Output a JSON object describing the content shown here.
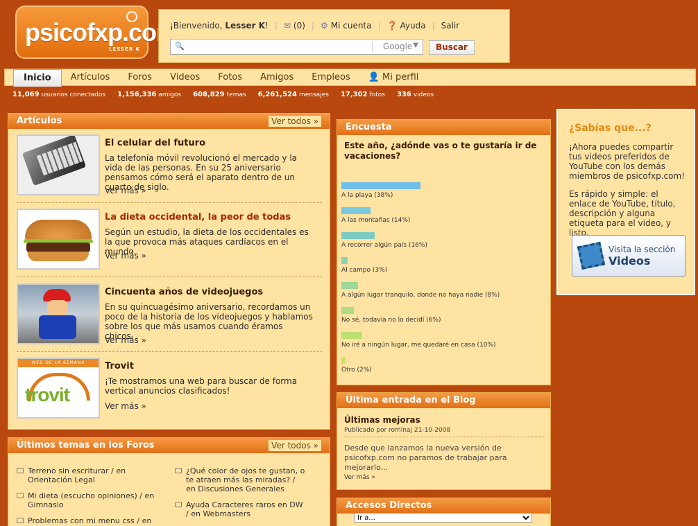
{
  "logo": {
    "text": "psicofxp.com",
    "user_tag": "LESSER K"
  },
  "header": {
    "welcome": "¡Bienvenido,",
    "username": "Lesser K",
    "welcome_end": "!",
    "messages": "(0)",
    "account": "Mi cuenta",
    "help": "Ayuda",
    "logout": "Salir",
    "search_placeholder": "",
    "search_engine": "Google",
    "search_button": "Buscar"
  },
  "nav": {
    "items": [
      "Inicio",
      "Artículos",
      "Foros",
      "Videos",
      "Fotos",
      "Amigos",
      "Empleos",
      "Mi perfil"
    ]
  },
  "stats": [
    {
      "value": "11,069",
      "label": "usuarios conectados"
    },
    {
      "value": "1,156,336",
      "label": "amigos"
    },
    {
      "value": "608,829",
      "label": "temas"
    },
    {
      "value": "6,261,524",
      "label": "mensajes"
    },
    {
      "value": "17,302",
      "label": "fotos"
    },
    {
      "value": "336",
      "label": "videos"
    }
  ],
  "articles": {
    "title": "Artículos",
    "see_all": "Ver todos »",
    "items": [
      {
        "title": "El celular del futuro",
        "text": "La telefonía móvil revolucionó el mercado y la vida de las personas. En su 25 aniversario pensamos cómo será el aparato dentro de un cuarto de siglo.",
        "more": "Ver más »"
      },
      {
        "title": "La dieta occidental, la peor de todas",
        "text": "Según un estudio, la dieta de los occidentales es la que provoca más ataques cardíacos en el mundo.",
        "more": "Ver más »"
      },
      {
        "title": "Cincuenta años de videojuegos",
        "text": "En su quincuagésimo aniversario, recordamos un poco de la historia de los videojuegos y hablamos sobre los que más usamos cuando éramos chicos.",
        "more": "Ver más »"
      },
      {
        "title": "Trovit",
        "text": "¡Te mostramos una web para buscar de forma vertical anuncios clasificados!",
        "more": "Ver más »",
        "badge": "WEB DE LA SEMANA",
        "brand": "trovit"
      }
    ]
  },
  "foros": {
    "title": "Últimos temas en los Foros",
    "see_all": "Ver todos »",
    "left": [
      "Terreno sin escriturar / en Orientación Legal",
      "Mi dieta (escucho opiniones) / en Gimnasio",
      "Problemas con mi menu css / en"
    ],
    "right": [
      "¿Qué color de ojos te gustan, o te atraen más las miradas? / en Discusiones Generales",
      "Ayuda Caracteres raros en DW / en Webmasters"
    ]
  },
  "encuesta": {
    "title": "Encuesta",
    "question": "Este año, ¿adónde vas o te gustaría ir de vacaciones?",
    "options": [
      {
        "label": "A la playa (38%)",
        "pct": 38,
        "color": "#6cc0ea"
      },
      {
        "label": "A las montañas (14%)",
        "pct": 14,
        "color": "#78c9e0"
      },
      {
        "label": "A recorrer algún país (16%)",
        "pct": 16,
        "color": "#7ccbc3"
      },
      {
        "label": "Al campo (3%)",
        "pct": 3,
        "color": "#8ed3b0"
      },
      {
        "label": "A algún lugar tranquilo, donde no haya nadie (8%)",
        "pct": 8,
        "color": "#9fd899"
      },
      {
        "label": "No sé, todavía no lo decidí (6%)",
        "pct": 6,
        "color": "#aedc85"
      },
      {
        "label": "No iré a ningún lugar, me quedaré en casa (10%)",
        "pct": 10,
        "color": "#bce072"
      },
      {
        "label": "Otro (2%)",
        "pct": 2,
        "color": "#c8e35f"
      }
    ]
  },
  "blog": {
    "title": "Última entrada en el Blog",
    "post_title": "Últimas mejoras",
    "published": "Publicado por rominaj 21-10-2008",
    "text": "Desde que lanzamos la nueva versión de psicofxp.com no paramos de trabajar para mejorarlo...",
    "more": "Ver más »"
  },
  "accesos": {
    "title": "Accesos Directos",
    "select_value": "Ir a..."
  },
  "sabias": {
    "title": "¿Sabías que...?",
    "p1": "¡Ahora puedes compartir tus videos preferidos de YouTube con los demás miembros de psicofxp.com!",
    "p2": "Es rápido y simple: el enlace de YouTube, título, descripción y alguna etiqueta para el video, y listo.",
    "button_line1": "Visita la sección",
    "button_line2": "Videos"
  }
}
